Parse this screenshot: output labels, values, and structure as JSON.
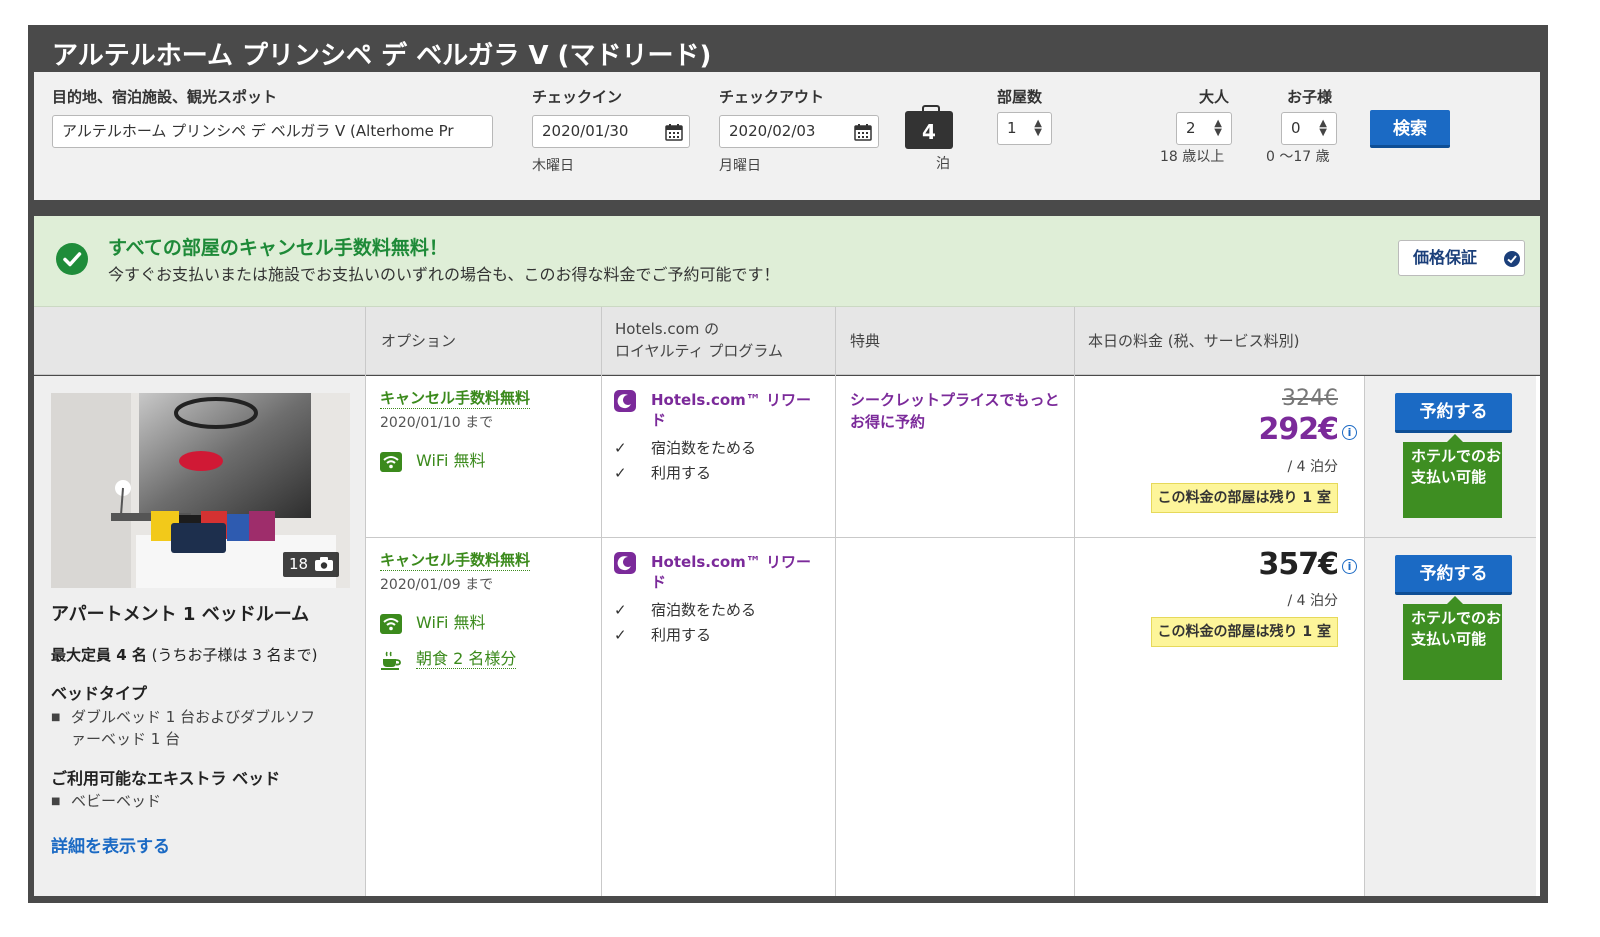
{
  "hotel": {
    "title": "アルテルホーム プリンシペ デ ベルガラ V (マドリード)"
  },
  "search": {
    "destination_label": "目的地、宿泊施設、観光スポット",
    "destination_value": "アルテルホーム プリンシペ デ ベルガラ V (Alterhome  Pr",
    "checkin_label": "チェックイン",
    "checkin_value": "2020/01/30",
    "checkin_day": "木曜日",
    "checkout_label": "チェックアウト",
    "checkout_value": "2020/02/03",
    "checkout_day": "月曜日",
    "nights_value": "4",
    "nights_unit": "泊",
    "rooms_label": "部屋数",
    "rooms_value": "1",
    "adults_label": "大人",
    "adults_value": "2",
    "adults_note": "18 歳以上",
    "children_label": "お子様",
    "children_value": "0",
    "children_note": "0 〜17 歳",
    "search_button": "検索"
  },
  "banner": {
    "title": "すべての部屋のキャンセル手数料無料！",
    "subtitle": "今すぐお支払いまたは施設でお支払いのいずれの場合も、このお得な料金でご予約可能です！",
    "guarantee_button": "価格保証"
  },
  "table": {
    "headers": {
      "options": "オプション",
      "loyalty_line1": "Hotels.com の",
      "loyalty_line2": "ロイヤルティ プログラム",
      "perks": "特典",
      "price": "本日の料金 (税、サービス料別)"
    }
  },
  "room": {
    "photo_count": "18",
    "name": "アパートメント 1 ベッドルーム",
    "occupancy_bold": "最大定員 4 名",
    "occupancy_note": " (うちお子様は 3 名まで)",
    "bed_type_title": "ベッドタイプ",
    "bed_type_line1": "ダブルベッド 1 台およびダブルソフ",
    "bed_type_line2": "ァーベッド 1 台",
    "extra_bed_title": "ご利用可能なエキストラ ベッド",
    "extra_bed_item": "ベビーベッド",
    "details_link": "詳細を表示する"
  },
  "rates": [
    {
      "cancel_label": "キャンセル手数料無料",
      "cancel_date": "2020/01/10 まで",
      "wifi": "WiFi 無料",
      "reward_title": "Hotels.com™ リワード",
      "reward_item1": "宿泊数をためる",
      "reward_item2": "利用する",
      "perk": "シークレットプライスでもっとお得に予約",
      "old_price": "324€",
      "price": "292€",
      "price_color": "#7b2a9a",
      "per_night": "/ 4 泊分",
      "rooms_left": "この料金の部屋は残り 1 室",
      "book_button": "予約する",
      "pay_at_hotel": "ホテルでのお支払い可能"
    },
    {
      "cancel_label": "キャンセル手数料無料",
      "cancel_date": "2020/01/09 まで",
      "wifi": "WiFi 無料",
      "breakfast": "朝食 2 名様分",
      "reward_title": "Hotels.com™ リワード",
      "reward_item1": "宿泊数をためる",
      "reward_item2": "利用する",
      "price": "357€",
      "price_color": "#222222",
      "per_night": "/ 4 泊分",
      "rooms_left": "この料金の部屋は残り 1 室",
      "book_button": "予約する",
      "pay_at_hotel": "ホテルでのお支払い可能"
    }
  ],
  "colors": {
    "accent_blue": "#1b6ac4",
    "success_green": "#1e8a38",
    "reward_purple": "#7b2a9a",
    "header_dark": "#4a4a4a"
  },
  "icons": {
    "calendar": "calendar-icon",
    "luggage": "luggage-icon",
    "check": "check-circle-icon",
    "wifi": "wifi-icon",
    "coffee": "coffee-cup-icon",
    "camera": "camera-icon",
    "reward": "hotels-reward-icon",
    "info": "info-icon"
  }
}
